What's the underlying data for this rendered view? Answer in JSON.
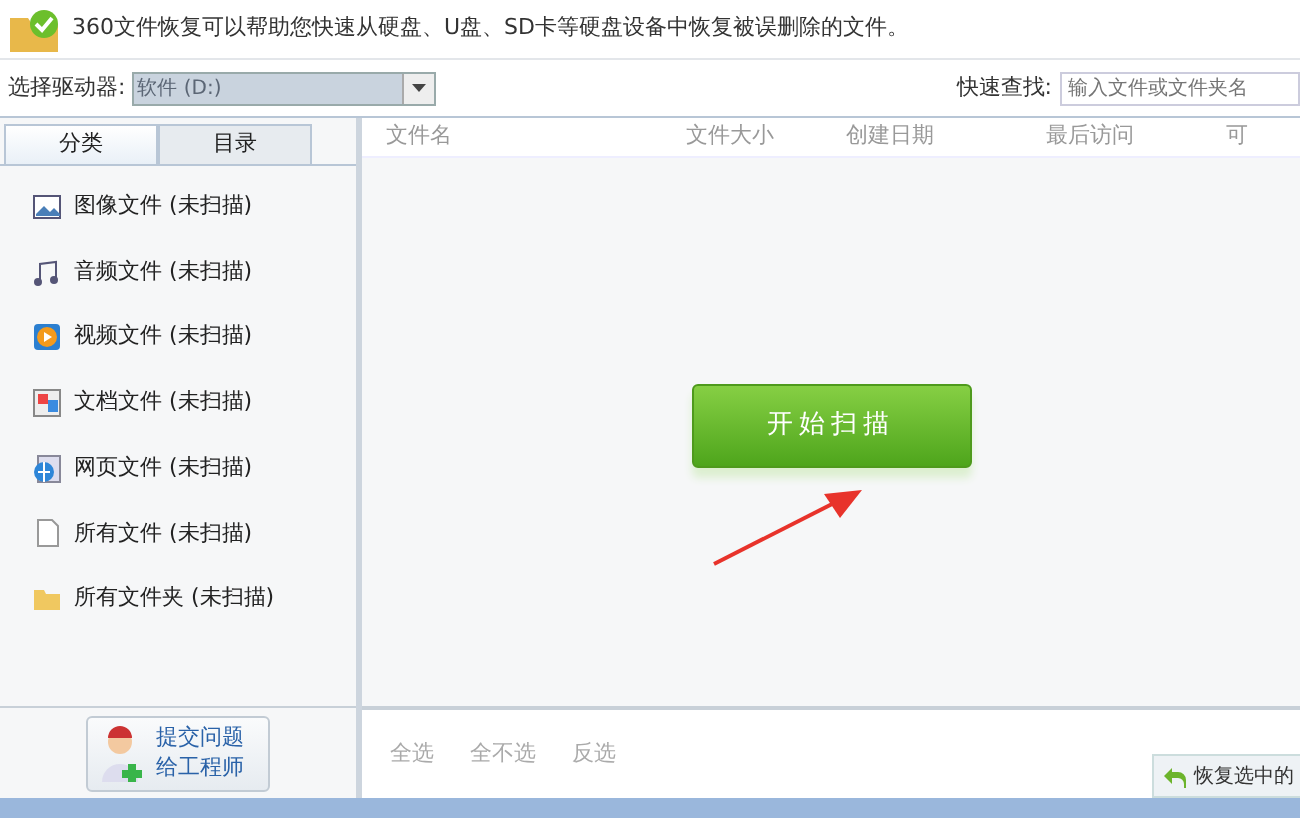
{
  "header": {
    "text": "360文件恢复可以帮助您快速从硬盘、U盘、SD卡等硬盘设备中恢复被误删除的文件。"
  },
  "toolbar": {
    "drive_label": "选择驱动器:",
    "drive_value": "软件 (D:)",
    "drive_disabled": true,
    "search_label": "快速查找:",
    "search_placeholder": "输入文件或文件夹名"
  },
  "tabs": [
    {
      "label": "分类",
      "selected": true
    },
    {
      "label": "目录",
      "selected": false
    }
  ],
  "categories": [
    {
      "kind": "image",
      "label": "图像文件 (未扫描)"
    },
    {
      "kind": "audio",
      "label": "音频文件 (未扫描)"
    },
    {
      "kind": "video",
      "label": "视频文件 (未扫描)"
    },
    {
      "kind": "document",
      "label": "文档文件 (未扫描)"
    },
    {
      "kind": "webpage",
      "label": "网页文件 (未扫描)"
    },
    {
      "kind": "file",
      "label": "所有文件 (未扫描)"
    },
    {
      "kind": "folder",
      "label": "所有文件夹 (未扫描)"
    }
  ],
  "help_button": {
    "line_1": "提交问题",
    "line_2": "给工程师"
  },
  "table": {
    "columns": [
      "文件名",
      "文件大小",
      "创建日期",
      "最后访问",
      "可"
    ]
  },
  "scan_button": "开始扫描",
  "selection_links": [
    "全选",
    "全不选",
    "反选"
  ],
  "restore_button": "恢复选中的"
}
